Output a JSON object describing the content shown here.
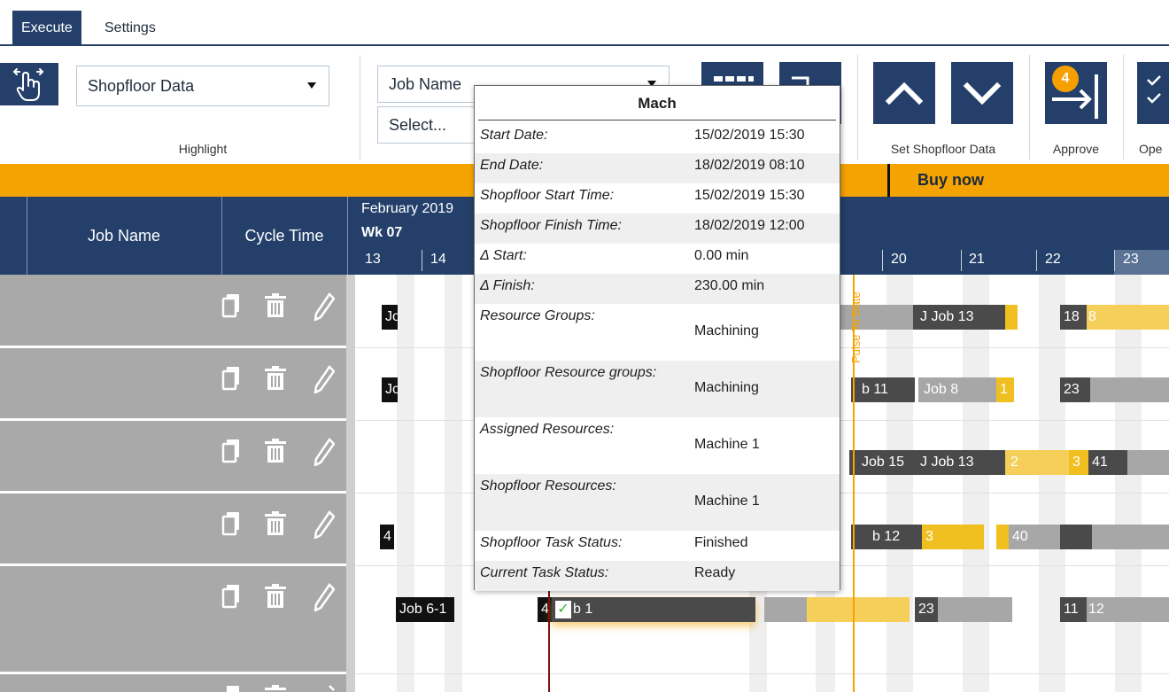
{
  "tabs": {
    "execute": "Execute",
    "settings": "Settings"
  },
  "ribbon": {
    "highlight_value": "Shopfloor Data",
    "highlight_label": "Highlight",
    "job_name_value": "Job Name",
    "select_placeholder": "Select...",
    "set_shopfloor_label": "Set Shopfloor Data",
    "approve_label": "Approve",
    "approve_badge": "4",
    "open_label": "Ope"
  },
  "banner": {
    "buy_now": "Buy now"
  },
  "header": {
    "job_name": "Job Name",
    "cycle_time": "Cycle Time",
    "month": "February 2019",
    "week": "Wk 07",
    "days": [
      "13",
      "14",
      "20",
      "21",
      "22",
      "23"
    ]
  },
  "gantt": {
    "pulse_label": "Pulse To Date",
    "bars": {
      "r1_a": "Jo",
      "r1_b": "J Job 13",
      "r1_c": "18",
      "r1_d": "8",
      "r2_a": "Jo",
      "r2_b": "b 11",
      "r2_c": "Job 8",
      "r2_d": "1",
      "r2_e": "23",
      "r3_b": "Job 15",
      "r3_c": "J Job 13",
      "r3_d": "2",
      "r3_e": "3",
      "r3_f": "41",
      "r4_a": "4",
      "r4_b": "b 12",
      "r4_c": "3",
      "r4_d": "40",
      "r5_a": "Job 6-1",
      "r5_b": "4",
      "r5_c": "b 1",
      "r5_d": "23",
      "r5_e": "11",
      "r5_f": "12"
    }
  },
  "tooltip": {
    "title": "Mach",
    "rows": [
      {
        "key": "Start Date:",
        "value": "15/02/2019 15:30"
      },
      {
        "key": "End Date:",
        "value": "18/02/2019 08:10"
      },
      {
        "key": "Shopfloor Start Time:",
        "value": "15/02/2019 15:30"
      },
      {
        "key": "Shopfloor Finish Time:",
        "value": "18/02/2019 12:00"
      },
      {
        "key": "Δ Start:",
        "value": "0.00 min"
      },
      {
        "key": "Δ Finish:",
        "value": "230.00 min"
      },
      {
        "key": "Resource Groups:",
        "value": "Machining"
      },
      {
        "key": "Shopfloor Resource groups:",
        "value": "Machining"
      },
      {
        "key": "Assigned Resources:",
        "value": "Machine 1"
      },
      {
        "key": "Shopfloor Resources:",
        "value": "Machine 1"
      },
      {
        "key": "Shopfloor Task Status:",
        "value": "Finished"
      },
      {
        "key": "Current Task Status:",
        "value": "Ready"
      }
    ]
  },
  "colors": {
    "navy": "#24406a",
    "orange": "#f5a300",
    "gold": "#f0c020",
    "dark_bar": "#4a4a4a",
    "grey_bar": "#a7a7a7",
    "row_grey": "#a9a9a9",
    "date_line": "#7a1010"
  }
}
